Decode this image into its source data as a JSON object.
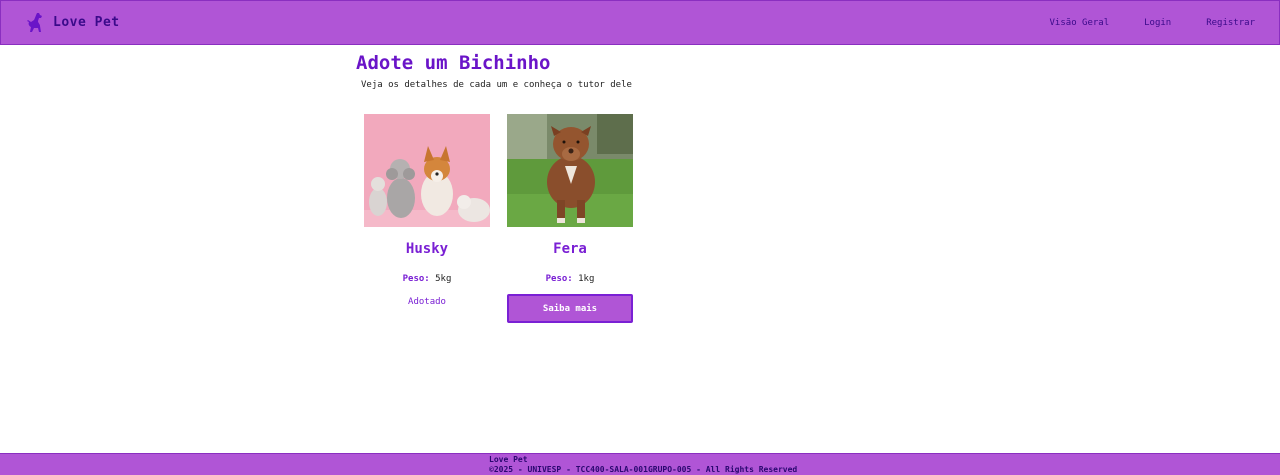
{
  "header": {
    "brand_name": "Love Pet",
    "logo_icon": "dog-silhouette-icon",
    "nav": [
      {
        "label": "Visão Geral"
      },
      {
        "label": "Login"
      },
      {
        "label": "Registrar"
      }
    ]
  },
  "main": {
    "title": "Adote um Bichinho",
    "subtitle": "Veja os detalhes de cada um e conheça o tutor dele",
    "pets": [
      {
        "name": "Husky",
        "weight_label": "Peso:",
        "weight_value": "5kg",
        "status": "Adotado",
        "image": "puppies-pink-background-photo"
      },
      {
        "name": "Fera",
        "weight_label": "Peso:",
        "weight_value": "1kg",
        "button_label": "Saiba mais",
        "image": "pitbull-grass-photo"
      }
    ]
  },
  "footer": {
    "line1": "Love Pet",
    "line2": "©2025 - UNIVESP - TCC400-SALA-001GRUPO-005 - All Rights Reserved"
  },
  "colors": {
    "accent": "#b055d6",
    "title": "#6a14c8",
    "brand_text": "#3a0a8a"
  }
}
